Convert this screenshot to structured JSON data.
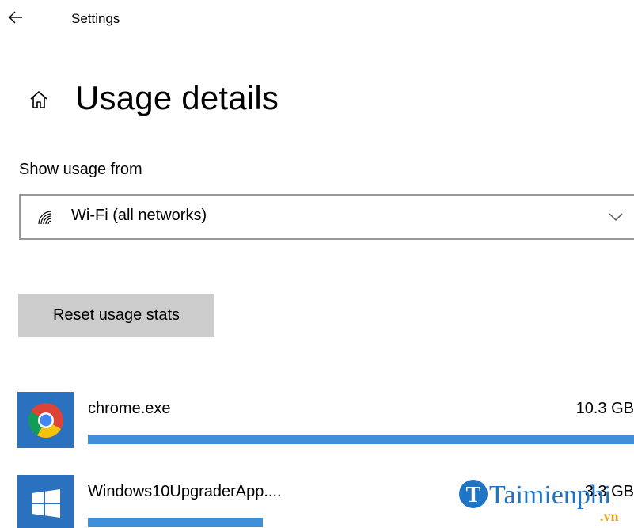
{
  "window": {
    "title": "Settings"
  },
  "page": {
    "title": "Usage details"
  },
  "filter": {
    "label": "Show usage from",
    "selected": "Wi-Fi (all networks)"
  },
  "actions": {
    "reset_label": "Reset usage stats"
  },
  "apps": [
    {
      "name": "chrome.exe",
      "usage": "10.3 GB",
      "usage_fraction": 1.0,
      "icon": "chrome-icon"
    },
    {
      "name": "Windows10UpgraderApp....",
      "usage": "3.3 GB",
      "usage_fraction": 0.32,
      "icon": "windows-icon"
    }
  ],
  "watermark": {
    "text": "Taimienphi",
    "suffix": ".vn"
  },
  "colors": {
    "accent": "#3f8fd9",
    "tile": "#2a71c0",
    "button": "#cccccc"
  }
}
